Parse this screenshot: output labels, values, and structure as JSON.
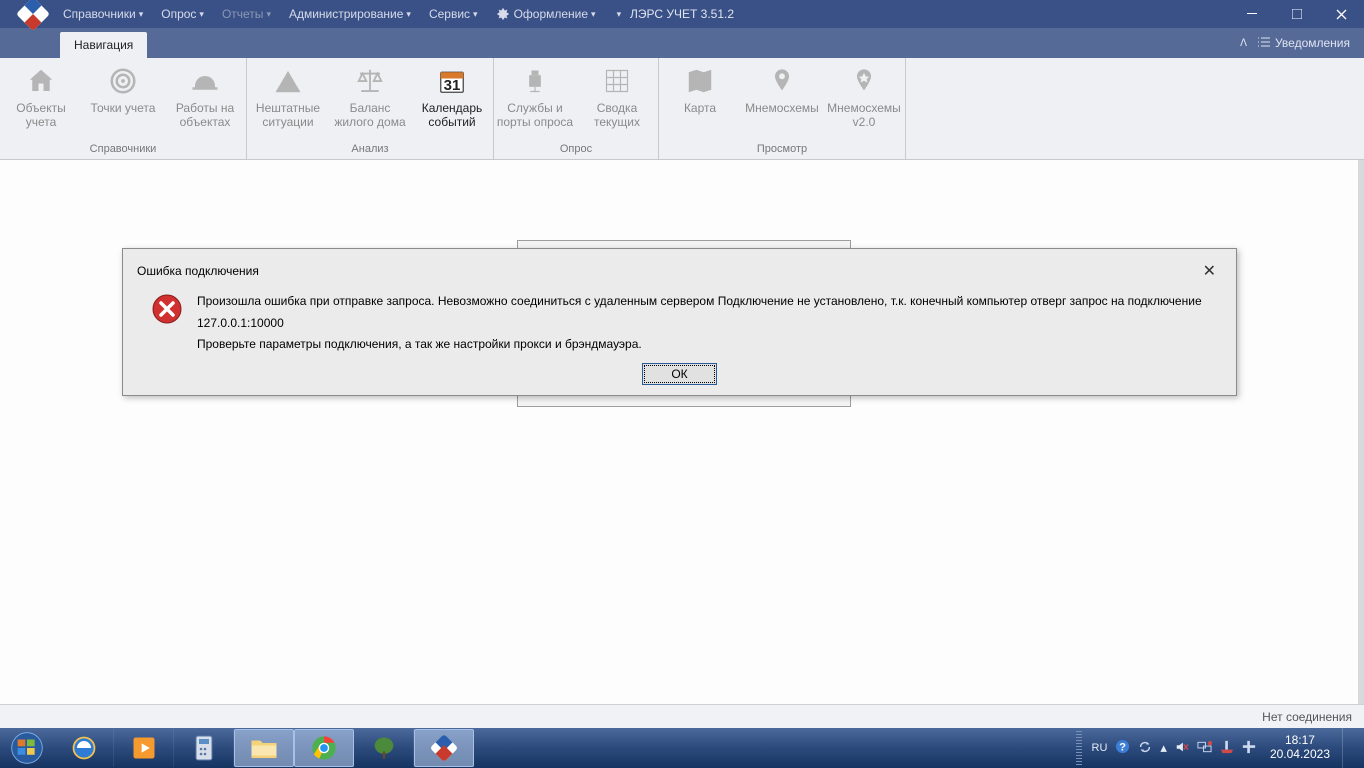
{
  "menu": {
    "items": [
      "Справочники",
      "Опрос",
      "Отчеты",
      "Администрирование",
      "Сервис"
    ],
    "theme_label": "Оформление"
  },
  "app_title": "ЛЭРС УЧЕТ 3.51.2",
  "tab_label": "Навигация",
  "notifications_label": "Уведомления",
  "ribbon": {
    "groups": [
      {
        "label": "Справочники",
        "buttons": [
          {
            "label": "Объекты учета",
            "icon": "home"
          },
          {
            "label": "Точки учета",
            "icon": "target"
          },
          {
            "label": "Работы на объектах",
            "icon": "helmet"
          }
        ]
      },
      {
        "label": "Анализ",
        "buttons": [
          {
            "label": "Нештатные ситуации",
            "icon": "triangle"
          },
          {
            "label": "Баланс жилого дома",
            "icon": "scales"
          },
          {
            "label": "Календарь событий",
            "icon": "calendar",
            "active": true
          }
        ]
      },
      {
        "label": "Опрос",
        "buttons": [
          {
            "label": "Службы и порты опроса",
            "icon": "camera"
          },
          {
            "label": "Сводка текущих",
            "icon": "grid"
          }
        ]
      },
      {
        "label": "Просмотр",
        "buttons": [
          {
            "label": "Карта",
            "icon": "map"
          },
          {
            "label": "Мнемосхемы",
            "icon": "pin"
          },
          {
            "label": "Мнемосхемы v2.0",
            "icon": "pin2"
          }
        ]
      }
    ]
  },
  "dialog": {
    "title": "Ошибка подключения",
    "line1": "Произошла ошибка при отправке запроса. Невозможно соединиться с удаленным сервером Подключение не установлено, т.к. конечный компьютер отверг запрос на подключение 127.0.0.1:10000",
    "line2": "Проверьте параметры подключения, а так же настройки прокси и брэндмауэра.",
    "ok": "ОК"
  },
  "status_text": "Нет соединения",
  "tray": {
    "lang": "RU",
    "time": "18:17",
    "date": "20.04.2023"
  }
}
